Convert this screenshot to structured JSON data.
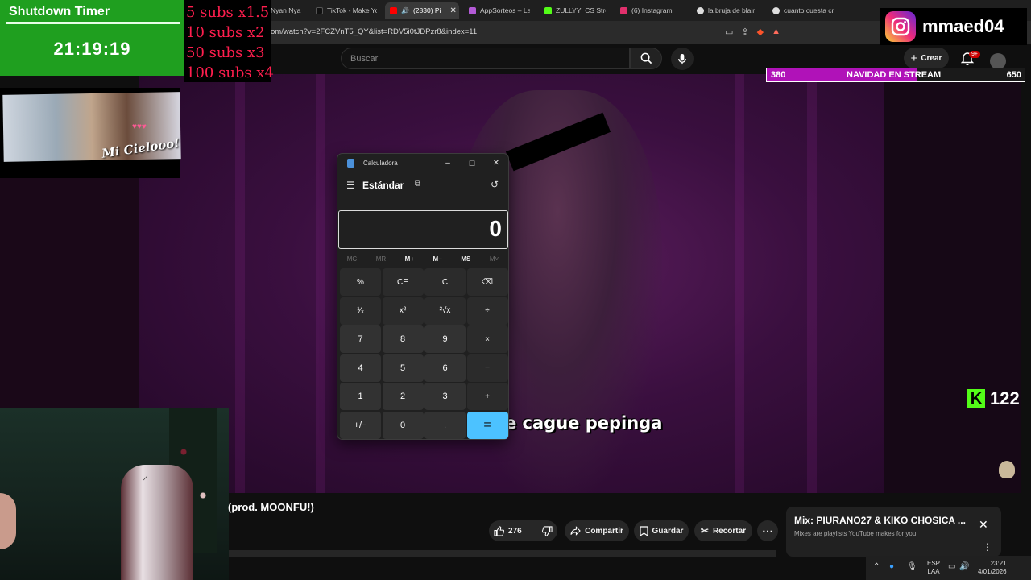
{
  "browser": {
    "tabs": [
      {
        "label": "Nyan Nya",
        "favicon": "#7aa7ff"
      },
      {
        "label": "TikTok - Make Yo",
        "favicon": "#111111"
      },
      {
        "label": "(2830) Pi",
        "favicon": "#ff0000",
        "active": true
      },
      {
        "label": "AppSorteos – La",
        "favicon": "#b35ad6"
      },
      {
        "label": "ZULLYY_CS Strea",
        "favicon": "#53fc18"
      },
      {
        "label": "(6) Instagram",
        "favicon": "#e1306c"
      },
      {
        "label": "la bruja de blair",
        "favicon": "#dddddd"
      },
      {
        "label": "cuanto cuesta cr",
        "favicon": "#dddddd"
      }
    ],
    "url": "om/watch?v=2FCZVnT5_QY&list=RDV5i0tJDPzr8&index=11"
  },
  "youtube": {
    "search_placeholder": "Buscar",
    "create_label": "Crear",
    "notifications_badge": "9+",
    "video_title": "(prod. MOONFU!)",
    "subtitle": "e cague pepinga",
    "likes": "276",
    "share_label": "Compartir",
    "save_label": "Guardar",
    "clip_label": "Recortar"
  },
  "mix_card": {
    "title": "Mix: PIURANO27 & KIKO CHOSICA ...",
    "subtitle": "Mixes are playlists YouTube makes for you"
  },
  "overlays": {
    "timer_title": "Shutdown Timer",
    "timer_value": "21:19:19",
    "subs_rules": [
      "5 subs x1.5",
      "10 subs x2",
      "50 subs x3",
      "100 subs x4"
    ],
    "photo_caption": "Mi Cielooo!",
    "instagram_handle": "mmaed04",
    "goal_current": "380",
    "goal_label": "NAVIDAD EN STREAM",
    "goal_target": "650",
    "goal_progress": 0.58,
    "kick_viewers": "122"
  },
  "calculator": {
    "window_title": "Calculadora",
    "mode": "Estándar",
    "display": "0",
    "memory": [
      {
        "label": "MC",
        "enabled": false
      },
      {
        "label": "MR",
        "enabled": false
      },
      {
        "label": "M+",
        "enabled": true
      },
      {
        "label": "M−",
        "enabled": true
      },
      {
        "label": "MS",
        "enabled": true
      },
      {
        "label": "M˅",
        "enabled": false
      }
    ],
    "keys": [
      "%",
      "CE",
      "C",
      "⌫",
      "¹⁄ₓ",
      "x²",
      "²√x",
      "÷",
      "7",
      "8",
      "9",
      "×",
      "4",
      "5",
      "6",
      "−",
      "1",
      "2",
      "3",
      "+",
      "+/−",
      "0",
      ".",
      "="
    ],
    "accent": "#4cc2ff"
  },
  "taskbar": {
    "lang_top": "ESP",
    "lang_bottom": "LAA",
    "time": "23:21",
    "date": "4/01/2026"
  }
}
